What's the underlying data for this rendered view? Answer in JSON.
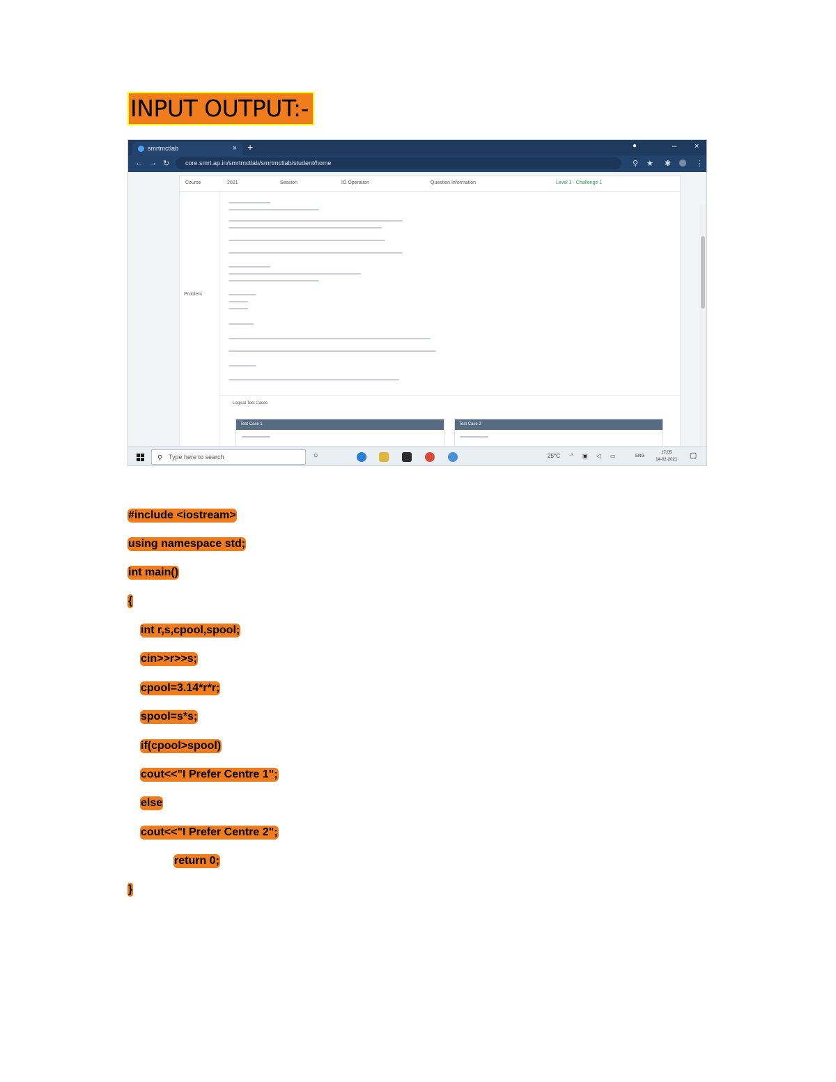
{
  "heading": "INPUT OUTPUT:-",
  "browser": {
    "tab_title": "smrtmctlab",
    "tab_close": "×",
    "new_tab": "+",
    "url": "core.smrt.ap.in/smrtmctlab/smrtmctlab/student/home"
  },
  "problem_panel": {
    "header_cells": [
      "Course",
      "2021",
      "Session",
      "IO Operation",
      "Question Information",
      "Level 1 · Challenge 1"
    ],
    "side_label": "Problem",
    "logical_test_cases": "Logical Test Cases",
    "test_case_1": "Test Case 1",
    "test_case_2": "Test Case 2"
  },
  "taskbar": {
    "search_placeholder": "Type here to search",
    "temperature": "25°C",
    "language": "ENG",
    "time": "17:05",
    "date": "14-02-2021"
  },
  "code_lines": [
    "#include <iostream>",
    "using namespace std;",
    "int main()",
    "{",
    "int r,s,cpool,spool;",
    "cin>>r>>s;",
    "cpool=3.14*r*r;",
    "spool=s*s;",
    "if(cpool>spool)",
    "cout<<\"I Prefer Centre 1\";",
    "else",
    "cout<<\"I Prefer Centre 2\";",
    "return 0;",
    "}"
  ]
}
